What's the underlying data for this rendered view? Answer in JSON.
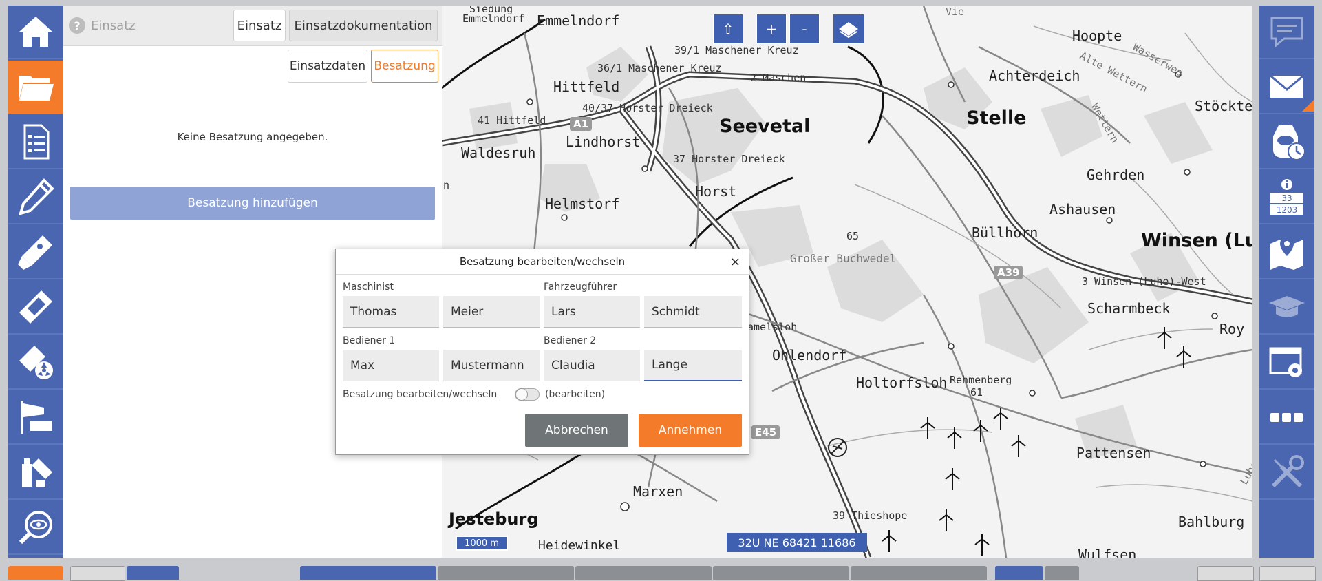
{
  "colors": {
    "accent": "#f47b2a",
    "sidebar": "#4a66b0",
    "primary_disabled": "#8fa3d6"
  },
  "sidebar_left": [
    {
      "icon": "home-icon"
    },
    {
      "icon": "folder-icon",
      "active": true
    },
    {
      "icon": "checklist-icon"
    },
    {
      "icon": "pen-icon"
    },
    {
      "icon": "gas-detector-icon"
    },
    {
      "icon": "measuring-device-icon"
    },
    {
      "icon": "radiation-meter-icon"
    },
    {
      "icon": "windsock-icon"
    },
    {
      "icon": "chemicals-icon"
    },
    {
      "icon": "search-eye-icon"
    }
  ],
  "sidebar_right": [
    {
      "icon": "chat-icon",
      "disabled": true
    },
    {
      "icon": "mail-icon"
    },
    {
      "icon": "respirator-timer-icon"
    },
    {
      "icon": "hazard-info-icon",
      "codes": {
        "top": "33",
        "bottom": "1203"
      }
    },
    {
      "icon": "map-pin-icon"
    },
    {
      "icon": "graduation-cap-icon",
      "disabled": true
    },
    {
      "icon": "settings-window-icon"
    },
    {
      "icon": "more-icon"
    },
    {
      "icon": "tools-icon",
      "disabled": true
    }
  ],
  "panel": {
    "title": "Einsatz",
    "tabs": {
      "einsatz": "Einsatz",
      "doku": "Einsatzdokumentation"
    },
    "subtabs": {
      "daten": "Einsatzdaten",
      "besatzung": "Besatzung"
    },
    "empty_message": "Keine Besatzung angegeben.",
    "add_button": "Besatzung hinzufügen"
  },
  "map": {
    "controls": {
      "up": "⇧",
      "zoom_in": "+",
      "zoom_out": "-"
    },
    "scale": "1000 m",
    "coordinates": "32U NE 68421 11686",
    "places": {
      "seevetal": "Seevetal",
      "stelle": "Stelle",
      "winsen": "Winsen (Luhe)",
      "emmelndorf": "Emmelndorf",
      "hittfeld": "Hittfeld",
      "lindhorst": "Lindhorst",
      "horst": "Horst",
      "helmstorf": "Helmstorf",
      "waldesruh": "Waldesruh",
      "achterdeich": "Achterdeich",
      "hoopte": "Hoopte",
      "stoeckte": "Stöckte",
      "gehrden": "Gehrden",
      "ashausen": "Ashausen",
      "buellhorn": "Büllhorn",
      "scharmbeck": "Scharmbeck",
      "ohlendorf": "Ohlendorf",
      "holtorfsloh": "Holtorfsloh",
      "pattensen": "Pattensen",
      "marxen": "Marxen",
      "jesteburg": "Jesteburg",
      "heidewinkel": "Heidewinkel",
      "bahlburg": "Bahlburg",
      "wulfsen": "Wulfsen",
      "rehmenberg": "Rehmenberg",
      "rehmenberg_height": "61",
      "grosser_buchwedel": "Großer Buchwedel",
      "height65": "65",
      "alte_wettern": "Alte Wettern",
      "wettern": "Wettern",
      "wasserweg": "Wasserweg",
      "junction_maschener_kreuz_391": "39/1 Maschener Kreuz",
      "junction_maschener_kreuz_361": "36/1 Maschener Kreuz",
      "junction_maschen": "2 Maschen",
      "junction_horster_dreieck_4037": "40/37 Horster Dreieck",
      "junction_hittfeld": "41 Hittfeld",
      "junction_horster_dreieck_37": "37 Horster Dreieck",
      "junction_winsen_west": "3 Winsen (Luhe)-West",
      "junction_thieshope": "39 Thieshope",
      "melsloh": "amelsloh",
      "roy": "Roy",
      "sieding": "Siedung",
      "emmelnd_top": "Emmelndorf",
      "vie": "Vie",
      "luhe": "Luhe",
      "stelle_small": "n"
    },
    "shields": {
      "a1": "A1",
      "a39": "A39",
      "e45": "E45"
    }
  },
  "dialog": {
    "title": "Besatzung bearbeiten/wechseln",
    "close": "×",
    "maschinist_label": "Maschinist",
    "fahrzeugfuehrer_label": "Fahrzeugführer",
    "bediener1_label": "Bediener 1",
    "bediener2_label": "Bediener 2",
    "maschinist": {
      "first": "Thomas",
      "last": "Meier"
    },
    "fahrzeugfuehrer": {
      "first": "Lars",
      "last": "Schmidt"
    },
    "bediener1": {
      "first": "Max",
      "last": "Mustermann"
    },
    "bediener2": {
      "first": "Claudia",
      "last": "Lange"
    },
    "toggle_label": "Besatzung bearbeiten/wechseln",
    "toggle_state": "(bearbeiten)",
    "cancel": "Abbrechen",
    "accept": "Annehmen"
  }
}
